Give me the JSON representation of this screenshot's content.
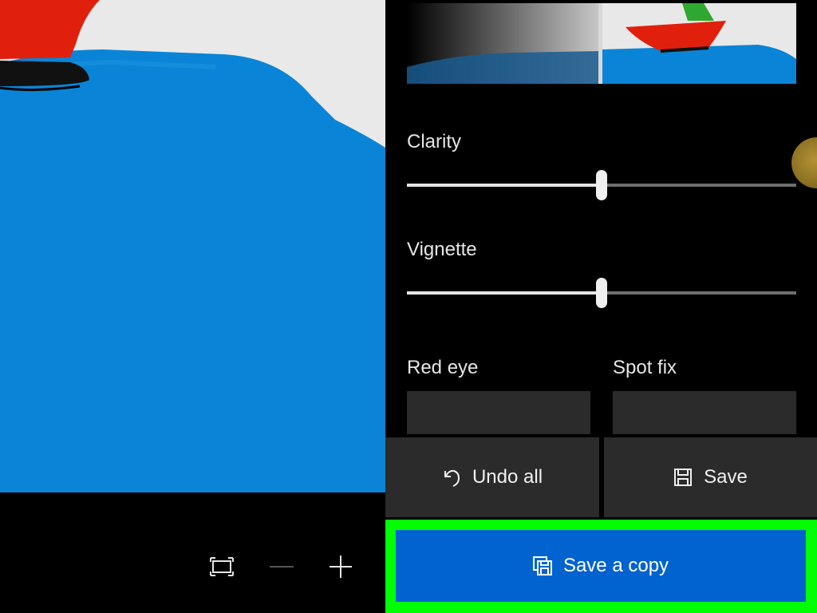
{
  "adjustments": {
    "clarity": {
      "label": "Clarity",
      "value": 0.5
    },
    "vignette": {
      "label": "Vignette",
      "value": 0.5
    }
  },
  "tools": {
    "red_eye": {
      "label": "Red eye"
    },
    "spot_fix": {
      "label": "Spot fix"
    }
  },
  "actions": {
    "undo_all": {
      "label": "Undo all",
      "icon": "undo-icon"
    },
    "save": {
      "label": "Save",
      "icon": "floppy-disk-icon"
    },
    "save_a_copy": {
      "label": "Save a copy",
      "icon": "save-copy-icon"
    }
  },
  "zoom_controls": {
    "fit_icon": "fit-to-window-icon",
    "zoom_out_icon": "minus-icon",
    "zoom_in_icon": "plus-icon"
  },
  "colors": {
    "accent": "#0063cf",
    "highlight_outline": "#00ff00",
    "panel_tile": "#2b2b2b",
    "water": "#0a84d6",
    "boat_red": "#e0200c"
  }
}
